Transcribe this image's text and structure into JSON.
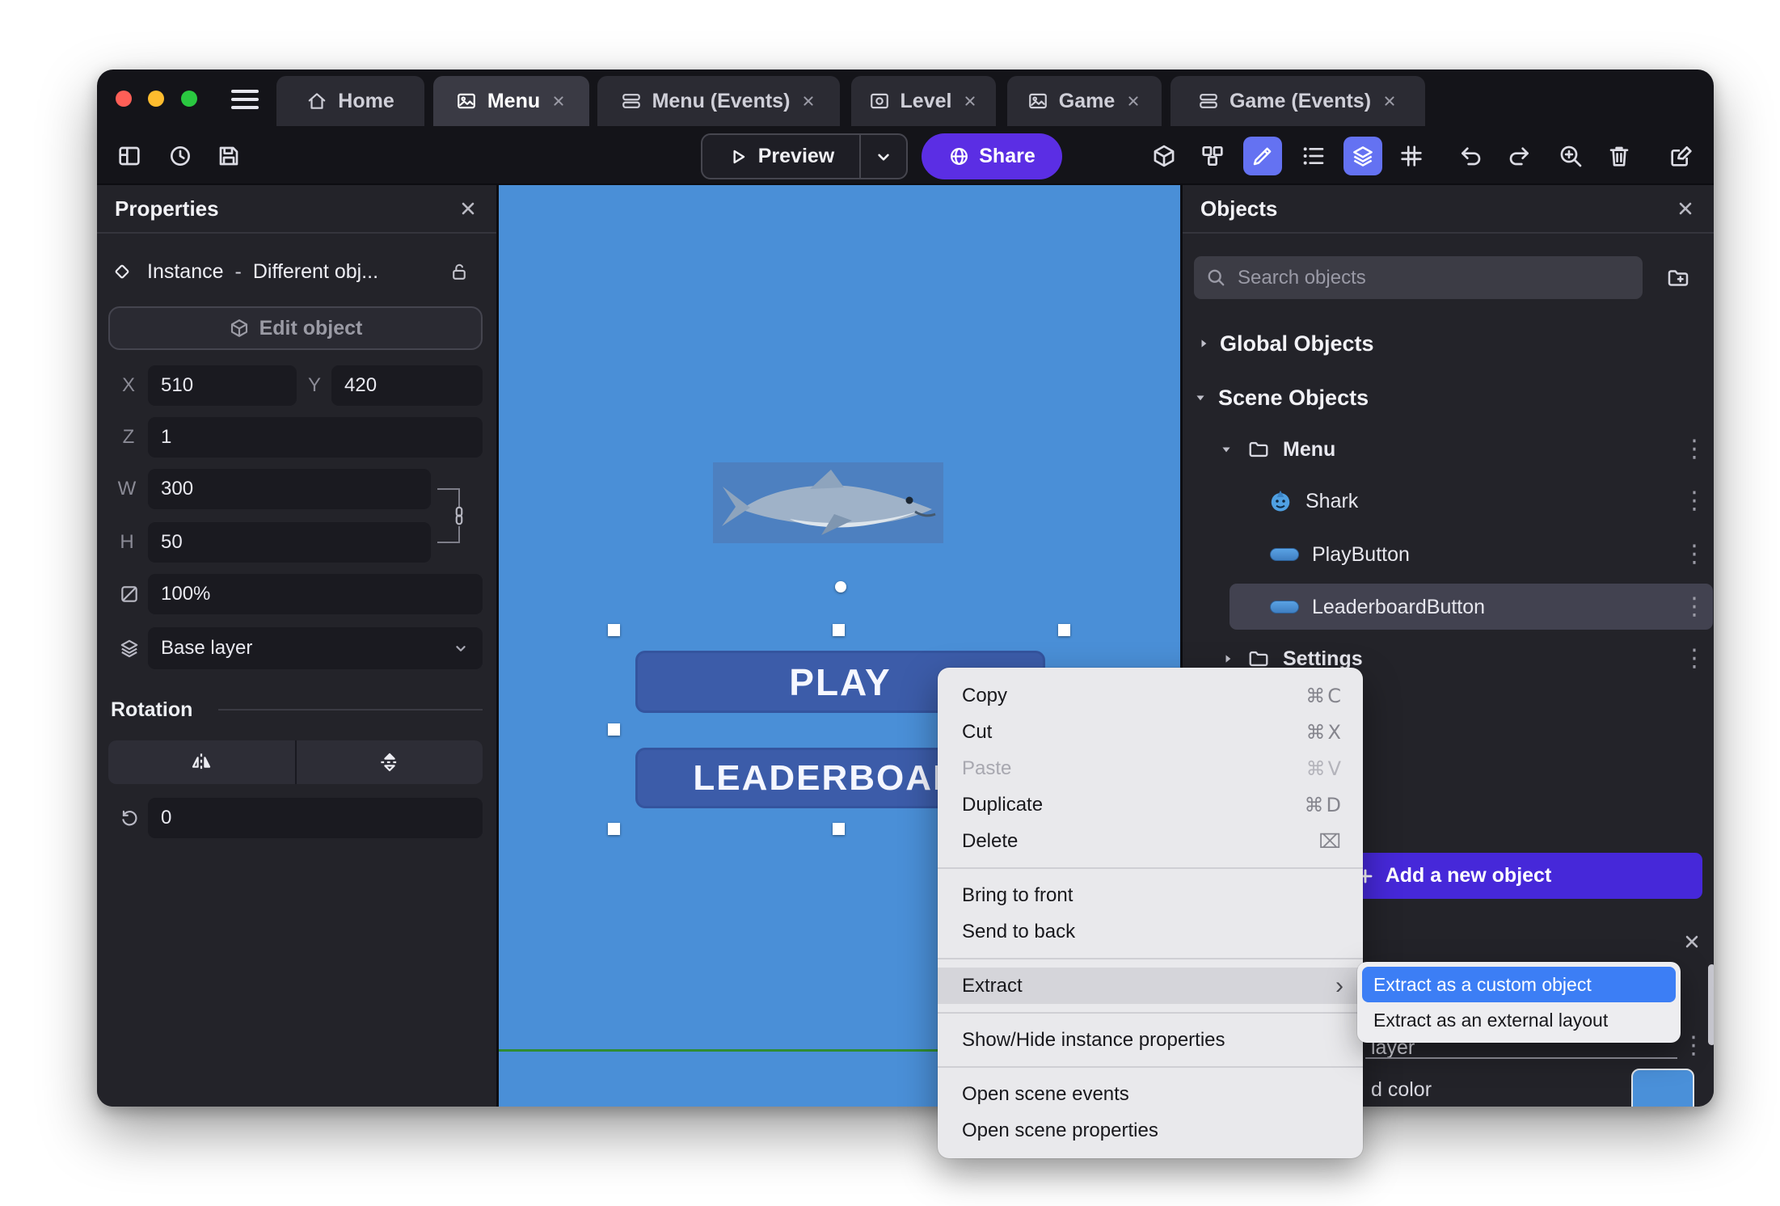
{
  "colors": {
    "canvas_blue": "#4a8fd7",
    "accent_purple": "#5b2ee4",
    "toolbar_highlight": "#6472f2",
    "add_button_purple": "#4628d9",
    "menu_selection_blue": "#3c7ef5",
    "background_swatch_blue": "#4a90d9"
  },
  "titlebar": {
    "tabs": [
      {
        "label": "Home"
      },
      {
        "label": "Menu"
      },
      {
        "label": "Menu (Events)"
      },
      {
        "label": "Level"
      },
      {
        "label": "Game"
      },
      {
        "label": "Game (Events)"
      }
    ]
  },
  "toolbar": {
    "preview_label": "Preview",
    "share_label": "Share"
  },
  "properties_panel": {
    "title": "Properties",
    "instance_type": "Instance",
    "instance_sep": "-",
    "instance_value": "Different obj...",
    "edit_object_label": "Edit object",
    "x_label": "X",
    "x_value": "510",
    "y_label": "Y",
    "y_value": "420",
    "z_label": "Z",
    "z_value": "1",
    "w_label": "W",
    "w_value": "300",
    "h_label": "H",
    "h_value": "50",
    "opacity_value": "100%",
    "layer_value": "Base layer",
    "rotation_title": "Rotation",
    "rotation_value": "0"
  },
  "canvas": {
    "play_button_label": "PLAY",
    "leaderboard_button_label": "LEADERBOARD"
  },
  "objects_panel": {
    "title": "Objects",
    "search_placeholder": "Search objects",
    "global_objects_label": "Global Objects",
    "scene_objects_label": "Scene Objects",
    "menu_folder_label": "Menu",
    "shark_label": "Shark",
    "play_button_label": "PlayButton",
    "leaderboard_button_label": "LeaderboardButton",
    "settings_folder_label": "Settings",
    "add_object_label": "Add a new object",
    "layer_fragment": "layer",
    "color_fragment": "d color"
  },
  "context_menu": {
    "copy": {
      "label": "Copy",
      "shortcut": "⌘C"
    },
    "cut": {
      "label": "Cut",
      "shortcut": "⌘X"
    },
    "paste": {
      "label": "Paste",
      "shortcut": "⌘V"
    },
    "duplicate": {
      "label": "Duplicate",
      "shortcut": "⌘D"
    },
    "delete": {
      "label": "Delete",
      "shortcut": "⌧"
    },
    "bring_to_front": {
      "label": "Bring to front"
    },
    "send_to_back": {
      "label": "Send to back"
    },
    "extract": {
      "label": "Extract"
    },
    "show_hide": {
      "label": "Show/Hide instance properties"
    },
    "open_scene_events": {
      "label": "Open scene events"
    },
    "open_scene_properties": {
      "label": "Open scene properties"
    }
  },
  "submenu": {
    "custom_object": "Extract as a custom object",
    "external_layout": "Extract as an external layout"
  }
}
